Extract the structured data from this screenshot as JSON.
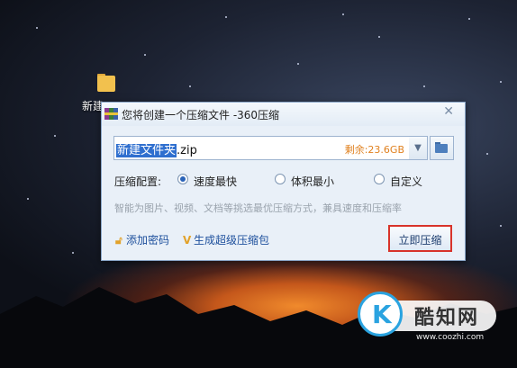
{
  "desktop": {
    "folder_label": "新建"
  },
  "dialog": {
    "title": "您将创建一个压缩文件 -360压缩",
    "file": {
      "selected_name": "新建文件夹",
      "extension": ".zip",
      "space_left": "剩余:23.6GB"
    },
    "config": {
      "label": "压缩配置:",
      "options": [
        {
          "label": "速度最快",
          "selected": true
        },
        {
          "label": "体积最小",
          "selected": false
        },
        {
          "label": "自定义",
          "selected": false
        }
      ]
    },
    "hint": "智能为图片、视频、文档等挑选最优压缩方式，兼具速度和压缩率",
    "add_password": "添加密码",
    "super_pack": "生成超级压缩包",
    "compress_now": "立即压缩"
  },
  "watermark": {
    "name": "酷知网",
    "url": "www.coozhi.com"
  }
}
